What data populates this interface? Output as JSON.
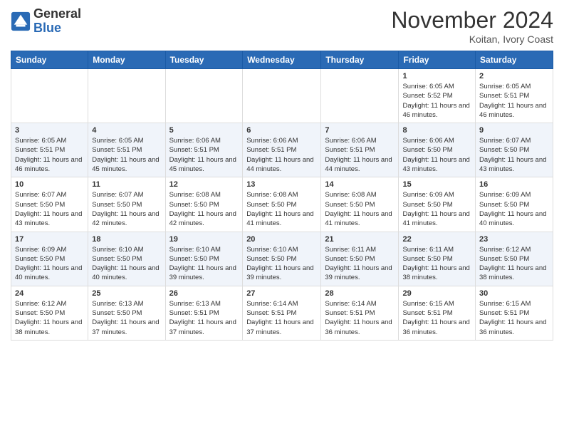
{
  "header": {
    "logo_general": "General",
    "logo_blue": "Blue",
    "month_title": "November 2024",
    "location": "Koitan, Ivory Coast"
  },
  "weekdays": [
    "Sunday",
    "Monday",
    "Tuesday",
    "Wednesday",
    "Thursday",
    "Friday",
    "Saturday"
  ],
  "weeks": [
    [
      {
        "day": "",
        "sunrise": "",
        "sunset": "",
        "daylight": ""
      },
      {
        "day": "",
        "sunrise": "",
        "sunset": "",
        "daylight": ""
      },
      {
        "day": "",
        "sunrise": "",
        "sunset": "",
        "daylight": ""
      },
      {
        "day": "",
        "sunrise": "",
        "sunset": "",
        "daylight": ""
      },
      {
        "day": "",
        "sunrise": "",
        "sunset": "",
        "daylight": ""
      },
      {
        "day": "1",
        "sunrise": "Sunrise: 6:05 AM",
        "sunset": "Sunset: 5:52 PM",
        "daylight": "Daylight: 11 hours and 46 minutes."
      },
      {
        "day": "2",
        "sunrise": "Sunrise: 6:05 AM",
        "sunset": "Sunset: 5:51 PM",
        "daylight": "Daylight: 11 hours and 46 minutes."
      }
    ],
    [
      {
        "day": "3",
        "sunrise": "Sunrise: 6:05 AM",
        "sunset": "Sunset: 5:51 PM",
        "daylight": "Daylight: 11 hours and 46 minutes."
      },
      {
        "day": "4",
        "sunrise": "Sunrise: 6:05 AM",
        "sunset": "Sunset: 5:51 PM",
        "daylight": "Daylight: 11 hours and 45 minutes."
      },
      {
        "day": "5",
        "sunrise": "Sunrise: 6:06 AM",
        "sunset": "Sunset: 5:51 PM",
        "daylight": "Daylight: 11 hours and 45 minutes."
      },
      {
        "day": "6",
        "sunrise": "Sunrise: 6:06 AM",
        "sunset": "Sunset: 5:51 PM",
        "daylight": "Daylight: 11 hours and 44 minutes."
      },
      {
        "day": "7",
        "sunrise": "Sunrise: 6:06 AM",
        "sunset": "Sunset: 5:51 PM",
        "daylight": "Daylight: 11 hours and 44 minutes."
      },
      {
        "day": "8",
        "sunrise": "Sunrise: 6:06 AM",
        "sunset": "Sunset: 5:50 PM",
        "daylight": "Daylight: 11 hours and 43 minutes."
      },
      {
        "day": "9",
        "sunrise": "Sunrise: 6:07 AM",
        "sunset": "Sunset: 5:50 PM",
        "daylight": "Daylight: 11 hours and 43 minutes."
      }
    ],
    [
      {
        "day": "10",
        "sunrise": "Sunrise: 6:07 AM",
        "sunset": "Sunset: 5:50 PM",
        "daylight": "Daylight: 11 hours and 43 minutes."
      },
      {
        "day": "11",
        "sunrise": "Sunrise: 6:07 AM",
        "sunset": "Sunset: 5:50 PM",
        "daylight": "Daylight: 11 hours and 42 minutes."
      },
      {
        "day": "12",
        "sunrise": "Sunrise: 6:08 AM",
        "sunset": "Sunset: 5:50 PM",
        "daylight": "Daylight: 11 hours and 42 minutes."
      },
      {
        "day": "13",
        "sunrise": "Sunrise: 6:08 AM",
        "sunset": "Sunset: 5:50 PM",
        "daylight": "Daylight: 11 hours and 41 minutes."
      },
      {
        "day": "14",
        "sunrise": "Sunrise: 6:08 AM",
        "sunset": "Sunset: 5:50 PM",
        "daylight": "Daylight: 11 hours and 41 minutes."
      },
      {
        "day": "15",
        "sunrise": "Sunrise: 6:09 AM",
        "sunset": "Sunset: 5:50 PM",
        "daylight": "Daylight: 11 hours and 41 minutes."
      },
      {
        "day": "16",
        "sunrise": "Sunrise: 6:09 AM",
        "sunset": "Sunset: 5:50 PM",
        "daylight": "Daylight: 11 hours and 40 minutes."
      }
    ],
    [
      {
        "day": "17",
        "sunrise": "Sunrise: 6:09 AM",
        "sunset": "Sunset: 5:50 PM",
        "daylight": "Daylight: 11 hours and 40 minutes."
      },
      {
        "day": "18",
        "sunrise": "Sunrise: 6:10 AM",
        "sunset": "Sunset: 5:50 PM",
        "daylight": "Daylight: 11 hours and 40 minutes."
      },
      {
        "day": "19",
        "sunrise": "Sunrise: 6:10 AM",
        "sunset": "Sunset: 5:50 PM",
        "daylight": "Daylight: 11 hours and 39 minutes."
      },
      {
        "day": "20",
        "sunrise": "Sunrise: 6:10 AM",
        "sunset": "Sunset: 5:50 PM",
        "daylight": "Daylight: 11 hours and 39 minutes."
      },
      {
        "day": "21",
        "sunrise": "Sunrise: 6:11 AM",
        "sunset": "Sunset: 5:50 PM",
        "daylight": "Daylight: 11 hours and 39 minutes."
      },
      {
        "day": "22",
        "sunrise": "Sunrise: 6:11 AM",
        "sunset": "Sunset: 5:50 PM",
        "daylight": "Daylight: 11 hours and 38 minutes."
      },
      {
        "day": "23",
        "sunrise": "Sunrise: 6:12 AM",
        "sunset": "Sunset: 5:50 PM",
        "daylight": "Daylight: 11 hours and 38 minutes."
      }
    ],
    [
      {
        "day": "24",
        "sunrise": "Sunrise: 6:12 AM",
        "sunset": "Sunset: 5:50 PM",
        "daylight": "Daylight: 11 hours and 38 minutes."
      },
      {
        "day": "25",
        "sunrise": "Sunrise: 6:13 AM",
        "sunset": "Sunset: 5:50 PM",
        "daylight": "Daylight: 11 hours and 37 minutes."
      },
      {
        "day": "26",
        "sunrise": "Sunrise: 6:13 AM",
        "sunset": "Sunset: 5:51 PM",
        "daylight": "Daylight: 11 hours and 37 minutes."
      },
      {
        "day": "27",
        "sunrise": "Sunrise: 6:14 AM",
        "sunset": "Sunset: 5:51 PM",
        "daylight": "Daylight: 11 hours and 37 minutes."
      },
      {
        "day": "28",
        "sunrise": "Sunrise: 6:14 AM",
        "sunset": "Sunset: 5:51 PM",
        "daylight": "Daylight: 11 hours and 36 minutes."
      },
      {
        "day": "29",
        "sunrise": "Sunrise: 6:15 AM",
        "sunset": "Sunset: 5:51 PM",
        "daylight": "Daylight: 11 hours and 36 minutes."
      },
      {
        "day": "30",
        "sunrise": "Sunrise: 6:15 AM",
        "sunset": "Sunset: 5:51 PM",
        "daylight": "Daylight: 11 hours and 36 minutes."
      }
    ]
  ]
}
